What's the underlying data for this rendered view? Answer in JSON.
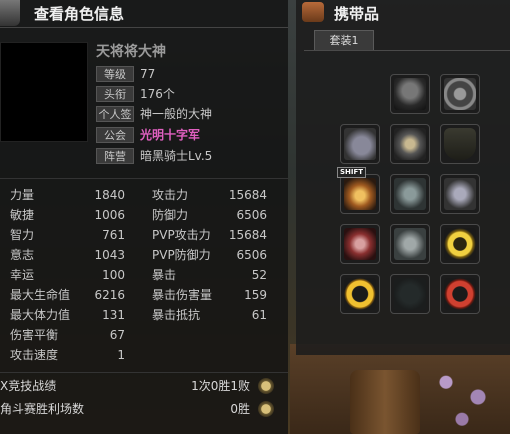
{
  "character_panel": {
    "title": "查看角色信息",
    "name": "天将将大神",
    "info": [
      {
        "label": "等级",
        "value": "77"
      },
      {
        "label": "头衔",
        "value": "176个"
      },
      {
        "label": "个人签",
        "value": "神一般的大神"
      },
      {
        "label": "公会",
        "value": "光明十字军"
      },
      {
        "label": "阵营",
        "value": "暗黑骑士Lv.5"
      }
    ],
    "stats_left": [
      {
        "label": "力量",
        "value": "1840"
      },
      {
        "label": "敏捷",
        "value": "1006"
      },
      {
        "label": "智力",
        "value": "761"
      },
      {
        "label": "意志",
        "value": "1043"
      },
      {
        "label": "幸运",
        "value": "100"
      },
      {
        "label": "最大生命值",
        "value": "6216"
      },
      {
        "label": "最大体力值",
        "value": "131"
      },
      {
        "label": "伤害平衡",
        "value": "67"
      },
      {
        "label": "攻击速度",
        "value": "1"
      }
    ],
    "stats_right": [
      {
        "label": "攻击力",
        "value": "15684"
      },
      {
        "label": "防御力",
        "value": "6506"
      },
      {
        "label": "PVP攻击力",
        "value": "15684"
      },
      {
        "label": "PVP防御力",
        "value": "6506"
      },
      {
        "label": "暴击",
        "value": "52"
      },
      {
        "label": "暴击伤害量",
        "value": "159"
      },
      {
        "label": "暴击抵抗",
        "value": "61"
      }
    ],
    "bottom": [
      {
        "label": "X竞技战绩",
        "value": "1次0胜1败"
      },
      {
        "label": "角斗赛胜利场数",
        "value": "0胜"
      }
    ]
  },
  "bag_panel": {
    "title": "携带品",
    "tab": "套装1",
    "slots": [
      {
        "icon": "helmet-icon"
      },
      {
        "icon": "medallion-icon"
      },
      {
        "icon": "gauntlet-icon"
      },
      {
        "icon": "chest-armor-icon"
      },
      {
        "icon": "shield-icon"
      },
      {
        "icon": "feather-scroll-icon",
        "badge": "SHIFT"
      },
      {
        "icon": "leg-armor-icon"
      },
      {
        "icon": "glove-icon"
      },
      {
        "icon": "belt-icon"
      },
      {
        "icon": "greaves-icon"
      },
      {
        "icon": "gold-ring-icon"
      },
      {
        "icon": "gold-band-icon"
      },
      {
        "icon": "empty-slot-icon"
      },
      {
        "icon": "red-ring-icon"
      }
    ]
  }
}
